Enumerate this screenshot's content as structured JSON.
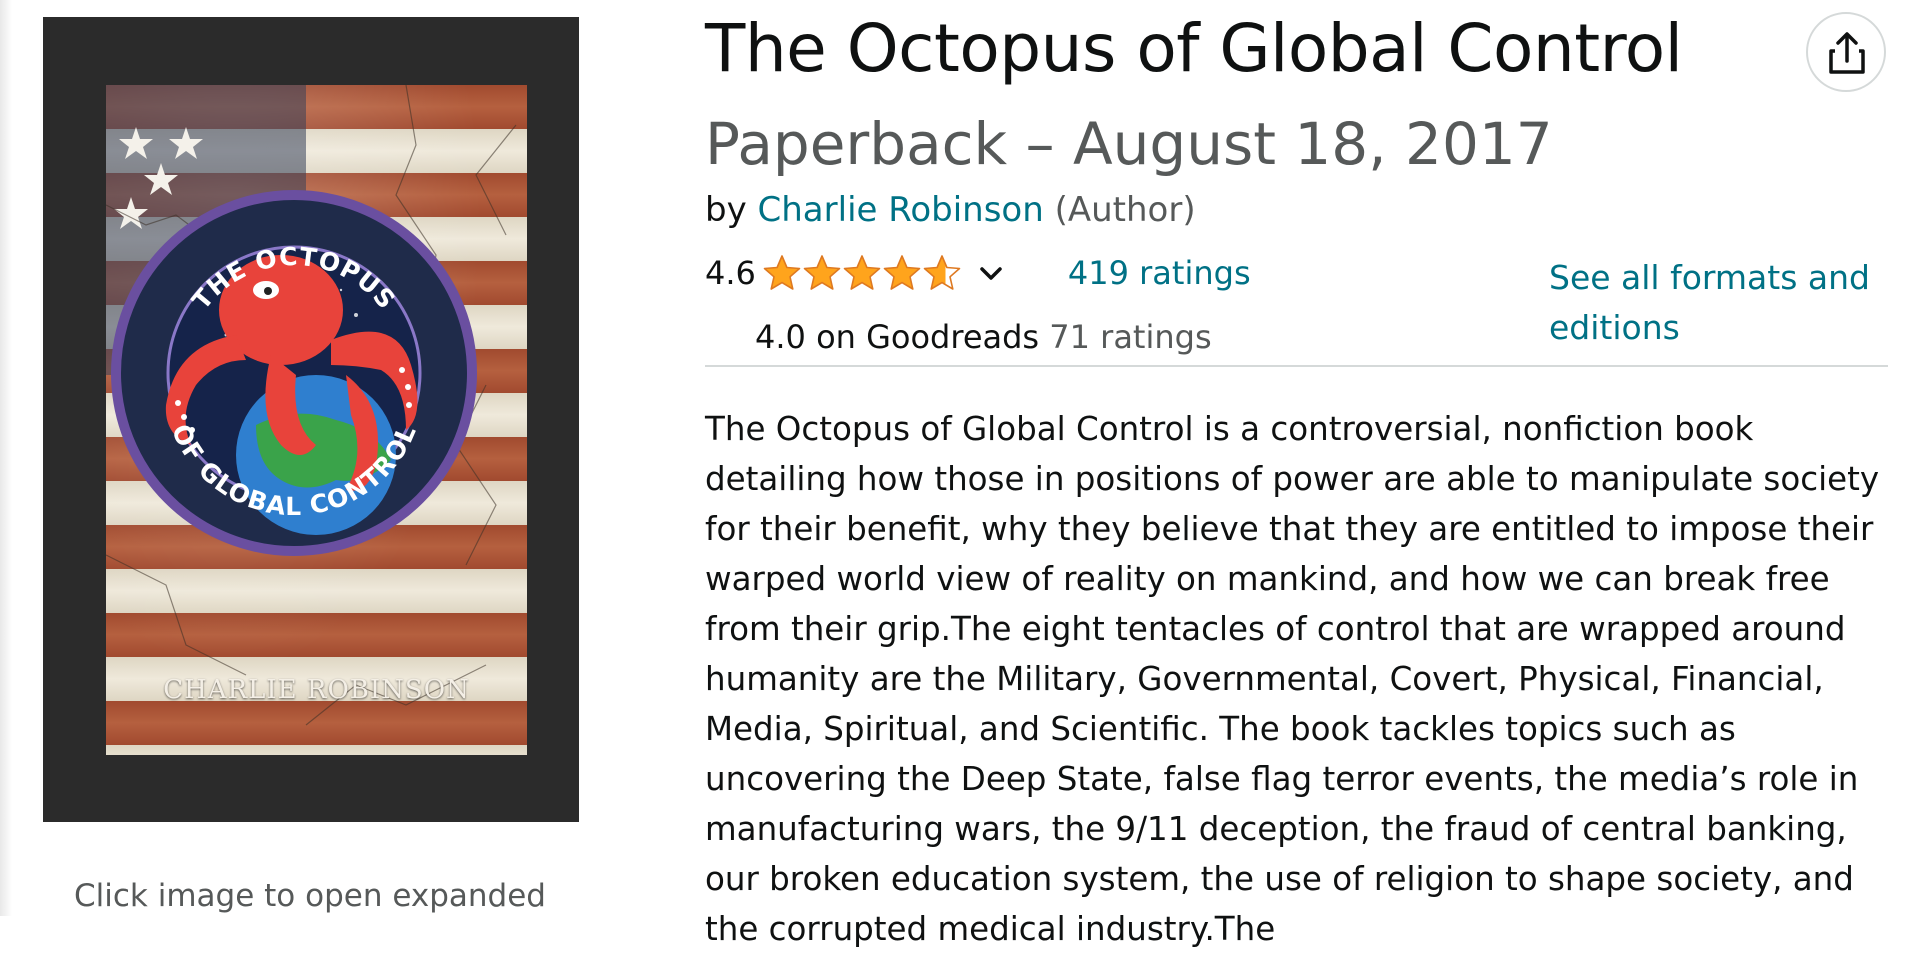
{
  "product": {
    "title": "The Octopus of Global Control",
    "format_date": "Paperback – August 18, 2017",
    "by_prefix": "by",
    "author": "Charlie Robinson",
    "author_role": "(Author)",
    "rating": "4.6",
    "rating_stars": 4.6,
    "ratings_count": "419 ratings",
    "formats_link": "See all formats and editions",
    "goodreads_rating": "4.0 on Goodreads",
    "goodreads_count": "71 ratings",
    "description": "The Octopus of Global Control is a controversial, nonfiction book detailing how those in positions of power are able to manipulate society for their benefit, why they believe that they are entitled to impose their warped world view of reality on mankind, and how we can break free from their grip.The eight tentacles of control that are wrapped around humanity are the Military, Governmental, Covert, Physical, Financial, Media, Spiritual, and Scientific. The book tackles topics such as uncovering the Deep State, false flag terror events, the media’s role in manufacturing wars, the 9/11 deception, the fraud of central banking, our broken education system, the use of religion to shape society, and the corrupted medical industry.The"
  },
  "cover": {
    "badge_top": "THE OCTOPUS",
    "badge_bottom": "OF GLOBAL CONTROL",
    "author": "CHARLIE ROBINSON",
    "caption": "Click image to open expanded"
  },
  "icons": {
    "share": "share-icon",
    "star": "star-icon",
    "chevron": "chevron-down-icon"
  },
  "colors": {
    "link": "#007185",
    "star": "#ffa41c",
    "muted": "#565959"
  }
}
